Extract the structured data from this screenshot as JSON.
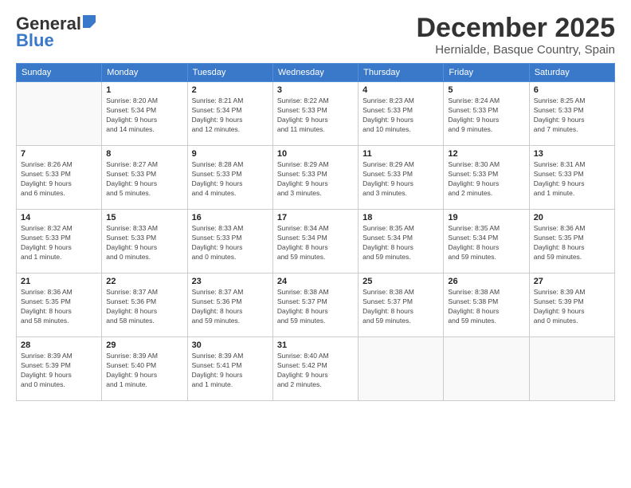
{
  "header": {
    "logo_line1": "General",
    "logo_line2": "Blue",
    "month": "December 2025",
    "location": "Hernialde, Basque Country, Spain"
  },
  "weekdays": [
    "Sunday",
    "Monday",
    "Tuesday",
    "Wednesday",
    "Thursday",
    "Friday",
    "Saturday"
  ],
  "weeks": [
    [
      {
        "day": "",
        "info": ""
      },
      {
        "day": "1",
        "info": "Sunrise: 8:20 AM\nSunset: 5:34 PM\nDaylight: 9 hours\nand 14 minutes."
      },
      {
        "day": "2",
        "info": "Sunrise: 8:21 AM\nSunset: 5:34 PM\nDaylight: 9 hours\nand 12 minutes."
      },
      {
        "day": "3",
        "info": "Sunrise: 8:22 AM\nSunset: 5:33 PM\nDaylight: 9 hours\nand 11 minutes."
      },
      {
        "day": "4",
        "info": "Sunrise: 8:23 AM\nSunset: 5:33 PM\nDaylight: 9 hours\nand 10 minutes."
      },
      {
        "day": "5",
        "info": "Sunrise: 8:24 AM\nSunset: 5:33 PM\nDaylight: 9 hours\nand 9 minutes."
      },
      {
        "day": "6",
        "info": "Sunrise: 8:25 AM\nSunset: 5:33 PM\nDaylight: 9 hours\nand 7 minutes."
      }
    ],
    [
      {
        "day": "7",
        "info": "Sunrise: 8:26 AM\nSunset: 5:33 PM\nDaylight: 9 hours\nand 6 minutes."
      },
      {
        "day": "8",
        "info": "Sunrise: 8:27 AM\nSunset: 5:33 PM\nDaylight: 9 hours\nand 5 minutes."
      },
      {
        "day": "9",
        "info": "Sunrise: 8:28 AM\nSunset: 5:33 PM\nDaylight: 9 hours\nand 4 minutes."
      },
      {
        "day": "10",
        "info": "Sunrise: 8:29 AM\nSunset: 5:33 PM\nDaylight: 9 hours\nand 3 minutes."
      },
      {
        "day": "11",
        "info": "Sunrise: 8:29 AM\nSunset: 5:33 PM\nDaylight: 9 hours\nand 3 minutes."
      },
      {
        "day": "12",
        "info": "Sunrise: 8:30 AM\nSunset: 5:33 PM\nDaylight: 9 hours\nand 2 minutes."
      },
      {
        "day": "13",
        "info": "Sunrise: 8:31 AM\nSunset: 5:33 PM\nDaylight: 9 hours\nand 1 minute."
      }
    ],
    [
      {
        "day": "14",
        "info": "Sunrise: 8:32 AM\nSunset: 5:33 PM\nDaylight: 9 hours\nand 1 minute."
      },
      {
        "day": "15",
        "info": "Sunrise: 8:33 AM\nSunset: 5:33 PM\nDaylight: 9 hours\nand 0 minutes."
      },
      {
        "day": "16",
        "info": "Sunrise: 8:33 AM\nSunset: 5:33 PM\nDaylight: 9 hours\nand 0 minutes."
      },
      {
        "day": "17",
        "info": "Sunrise: 8:34 AM\nSunset: 5:34 PM\nDaylight: 8 hours\nand 59 minutes."
      },
      {
        "day": "18",
        "info": "Sunrise: 8:35 AM\nSunset: 5:34 PM\nDaylight: 8 hours\nand 59 minutes."
      },
      {
        "day": "19",
        "info": "Sunrise: 8:35 AM\nSunset: 5:34 PM\nDaylight: 8 hours\nand 59 minutes."
      },
      {
        "day": "20",
        "info": "Sunrise: 8:36 AM\nSunset: 5:35 PM\nDaylight: 8 hours\nand 59 minutes."
      }
    ],
    [
      {
        "day": "21",
        "info": "Sunrise: 8:36 AM\nSunset: 5:35 PM\nDaylight: 8 hours\nand 58 minutes."
      },
      {
        "day": "22",
        "info": "Sunrise: 8:37 AM\nSunset: 5:36 PM\nDaylight: 8 hours\nand 58 minutes."
      },
      {
        "day": "23",
        "info": "Sunrise: 8:37 AM\nSunset: 5:36 PM\nDaylight: 8 hours\nand 59 minutes."
      },
      {
        "day": "24",
        "info": "Sunrise: 8:38 AM\nSunset: 5:37 PM\nDaylight: 8 hours\nand 59 minutes."
      },
      {
        "day": "25",
        "info": "Sunrise: 8:38 AM\nSunset: 5:37 PM\nDaylight: 8 hours\nand 59 minutes."
      },
      {
        "day": "26",
        "info": "Sunrise: 8:38 AM\nSunset: 5:38 PM\nDaylight: 8 hours\nand 59 minutes."
      },
      {
        "day": "27",
        "info": "Sunrise: 8:39 AM\nSunset: 5:39 PM\nDaylight: 9 hours\nand 0 minutes."
      }
    ],
    [
      {
        "day": "28",
        "info": "Sunrise: 8:39 AM\nSunset: 5:39 PM\nDaylight: 9 hours\nand 0 minutes."
      },
      {
        "day": "29",
        "info": "Sunrise: 8:39 AM\nSunset: 5:40 PM\nDaylight: 9 hours\nand 1 minute."
      },
      {
        "day": "30",
        "info": "Sunrise: 8:39 AM\nSunset: 5:41 PM\nDaylight: 9 hours\nand 1 minute."
      },
      {
        "day": "31",
        "info": "Sunrise: 8:40 AM\nSunset: 5:42 PM\nDaylight: 9 hours\nand 2 minutes."
      },
      {
        "day": "",
        "info": ""
      },
      {
        "day": "",
        "info": ""
      },
      {
        "day": "",
        "info": ""
      }
    ]
  ]
}
